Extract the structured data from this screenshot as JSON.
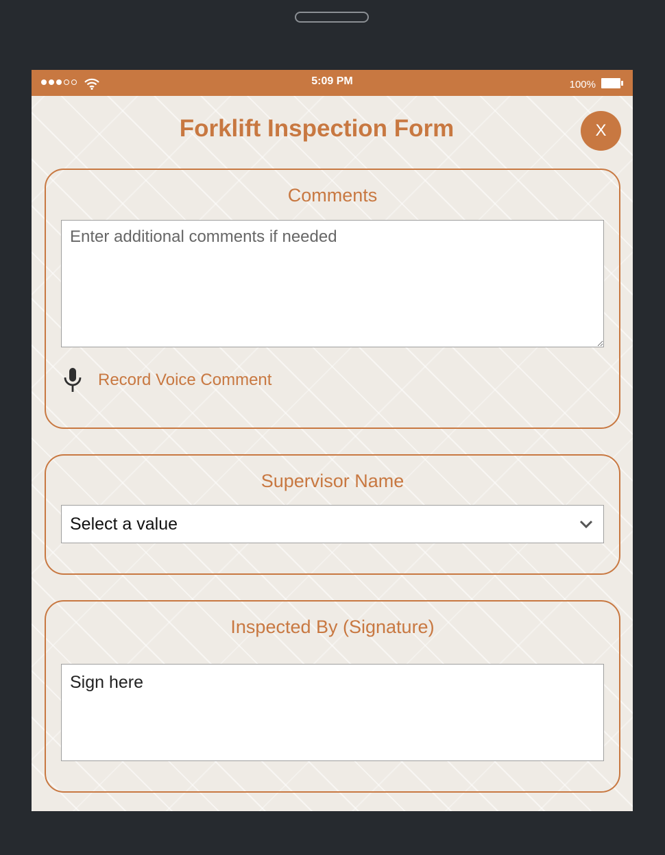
{
  "status_bar": {
    "time": "5:09 PM",
    "battery_percent": "100%",
    "signal_bars_filled": 3,
    "signal_bars_total": 5,
    "icons": [
      "signal-dots-icon",
      "wifi-icon",
      "battery-icon"
    ]
  },
  "form": {
    "title": "Forklift Inspection Form",
    "close_label": "X"
  },
  "comments": {
    "heading": "Comments",
    "placeholder": "Enter additional comments if needed",
    "value": "",
    "voice_label": "Record Voice Comment",
    "voice_icon": "microphone-icon"
  },
  "supervisor": {
    "heading": "Supervisor Name",
    "selected": "Select a value",
    "dropdown_icon": "chevron-down-icon"
  },
  "signature": {
    "heading": "Inspected By (Signature)",
    "placeholder": "Sign here"
  },
  "colors": {
    "accent": "#c87841",
    "background": "#efebe5",
    "device": "#262a2f"
  }
}
